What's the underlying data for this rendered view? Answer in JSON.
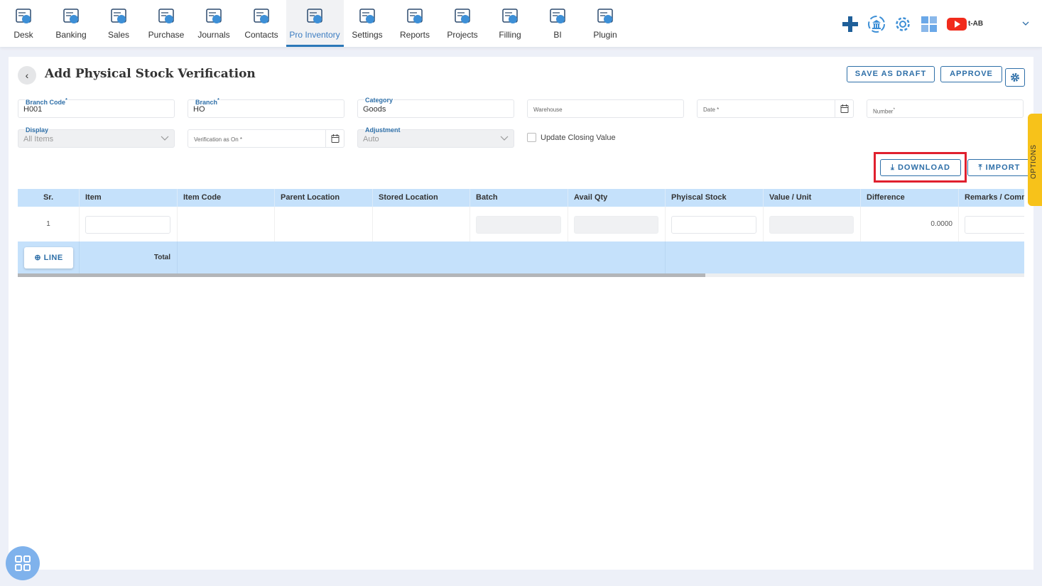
{
  "nav": {
    "items": [
      {
        "label": "Desk",
        "icon": "desk-icon"
      },
      {
        "label": "Banking",
        "icon": "bank-icon"
      },
      {
        "label": "Sales",
        "icon": "sales-icon"
      },
      {
        "label": "Purchase",
        "icon": "purchase-icon"
      },
      {
        "label": "Journals",
        "icon": "journals-icon"
      },
      {
        "label": "Contacts",
        "icon": "contacts-icon"
      },
      {
        "label": "Pro Inventory",
        "icon": "inventory-icon",
        "active": true
      },
      {
        "label": "Settings",
        "icon": "settings-icon"
      },
      {
        "label": "Reports",
        "icon": "reports-icon"
      },
      {
        "label": "Projects",
        "icon": "projects-icon"
      },
      {
        "label": "Filling",
        "icon": "filling-icon"
      },
      {
        "label": "BI",
        "icon": "bi-icon"
      },
      {
        "label": "Plugin",
        "icon": "plugin-icon"
      }
    ],
    "user_label": "t-AB"
  },
  "page": {
    "title": "Add Physical Stock Verification",
    "save_draft": "SAVE AS DRAFT",
    "approve": "APPROVE",
    "download": "DOWNLOAD",
    "import": "IMPORT",
    "options": "OPTIONS"
  },
  "form": {
    "branch_code": {
      "label": "Branch Code",
      "required": "*",
      "value": "H001"
    },
    "branch": {
      "label": "Branch",
      "required": "*",
      "value": "HO"
    },
    "category": {
      "label": "Category",
      "value": "Goods"
    },
    "warehouse": {
      "placeholder": "Warehouse"
    },
    "date": {
      "placeholder": "Date *"
    },
    "number": {
      "placeholder": "Number",
      "required": "*"
    },
    "display": {
      "label": "Display",
      "value": "All Items"
    },
    "verification": {
      "placeholder": "Verification as On *"
    },
    "adjustment": {
      "label": "Adjustment",
      "value": "Auto"
    },
    "update_closing": {
      "label": "Update Closing Value",
      "checked": false
    }
  },
  "table": {
    "columns": [
      "Sr.",
      "Item",
      "Item Code",
      "Parent Location",
      "Stored Location",
      "Batch",
      "Avail Qty",
      "Phyiscal Stock",
      "Value / Unit",
      "Difference",
      "Remarks / Comm"
    ],
    "rows": [
      {
        "sr": "1",
        "difference": "0.0000"
      }
    ],
    "add_line": "LINE",
    "total_label": "Total"
  },
  "colors": {
    "accent": "#2e6fa8",
    "header_bg": "#c5e1fb",
    "highlight": "#e0202e",
    "options_tab": "#f7c21a"
  }
}
